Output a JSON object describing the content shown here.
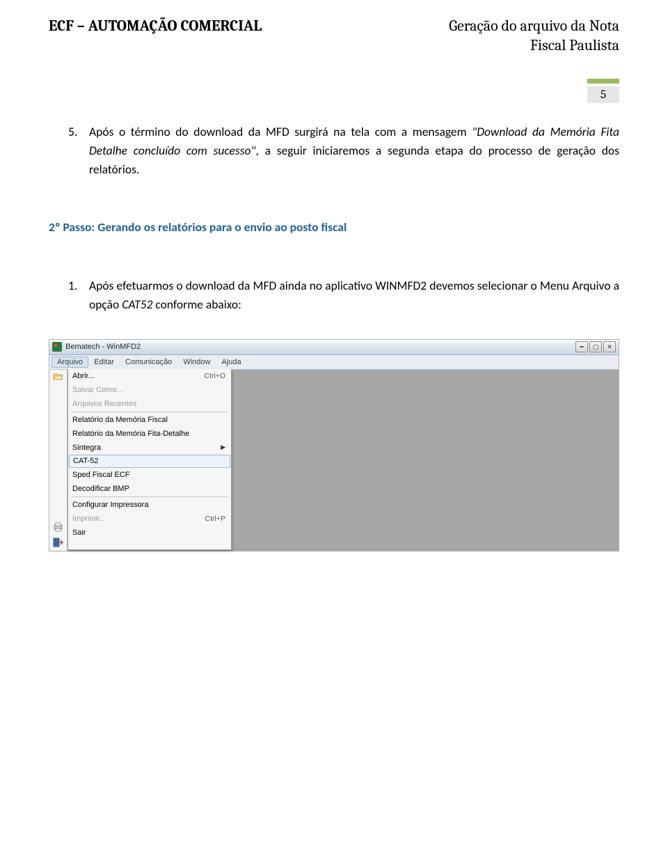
{
  "header": {
    "left": "ECF – AUTOMAÇÃO COMERCIAL",
    "right_line1": "Geração do arquivo da Nota",
    "right_line2": "Fiscal Paulista"
  },
  "page_number": "5",
  "paragraph5": {
    "num": "5.",
    "prefix": "Após o término do download da MFD surgirá na tela com a mensagem ",
    "italic": "\"Download da Memória Fita Detalhe concluído com sucesso\"",
    "suffix": ", a seguir iniciaremos a segunda etapa do processo de geração dos relatórios."
  },
  "section_title": "2º Passo: Gerando os relatórios para o envio ao posto fiscal",
  "paragraph1": {
    "num": "1.",
    "prefix": "Após efetuarmos o download da MFD ainda no aplicativo WINMFD2 devemos selecionar o Menu Arquivo a opção ",
    "italic": "CAT52",
    "suffix": " conforme abaixo:"
  },
  "app": {
    "title": "Bematech - WinMFD2",
    "menubar": [
      "Arquivo",
      "Editar",
      "Comunicação",
      "Window",
      "Ajuda"
    ],
    "active_menu_index": 0,
    "dropdown": [
      {
        "label": "Abrir...",
        "shortcut": "Ctrl+O",
        "kind": "item"
      },
      {
        "label": "Salvar Como...",
        "kind": "disabled"
      },
      {
        "label": "Arquivos Recentes",
        "kind": "disabled"
      },
      {
        "kind": "sep"
      },
      {
        "label": "Relatório da Memória Fiscal",
        "kind": "item"
      },
      {
        "label": "Relatório da Memória Fita-Detalhe",
        "kind": "item"
      },
      {
        "label": "Sintegra",
        "kind": "submenu"
      },
      {
        "label": "CAT-52",
        "kind": "highlight"
      },
      {
        "label": "Sped Fiscal ECF",
        "kind": "item"
      },
      {
        "label": "Decodificar BMP",
        "kind": "item"
      },
      {
        "kind": "sep"
      },
      {
        "label": "Configurar Impressora",
        "kind": "item"
      },
      {
        "label": "Imprimir..",
        "shortcut": "Ctrl+P",
        "kind": "disabled"
      },
      {
        "label": "Sair",
        "kind": "item"
      }
    ]
  }
}
